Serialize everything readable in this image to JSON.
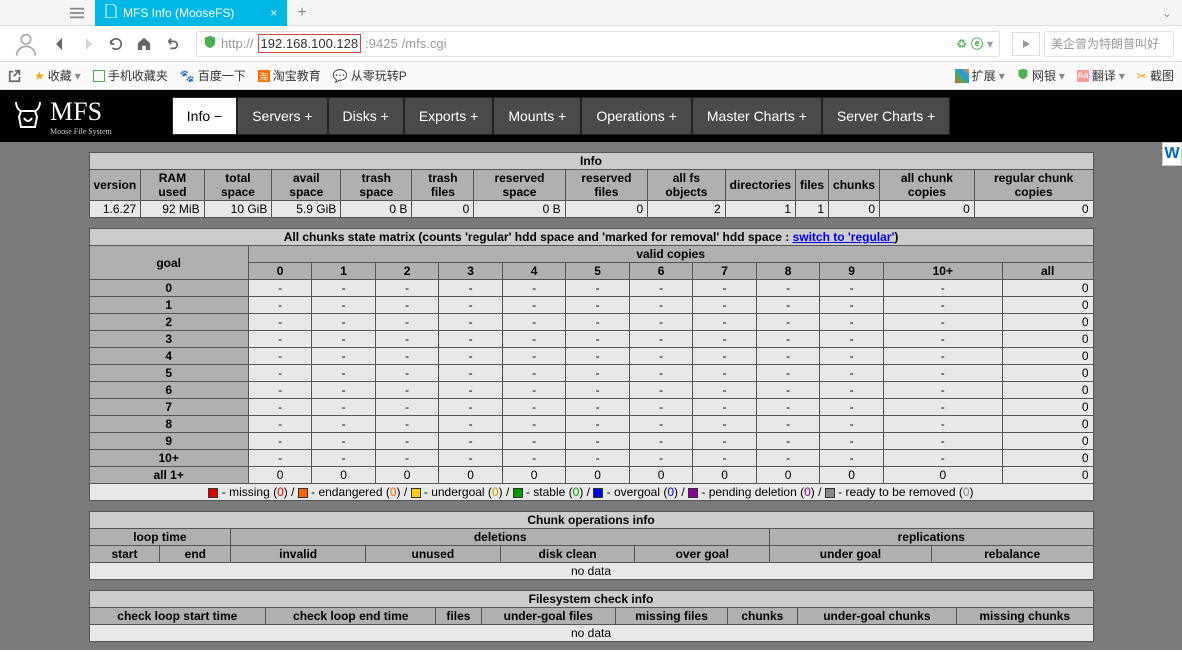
{
  "browser": {
    "tab_title": "MFS Info (MooseFS)",
    "url_display": "http://192.168.100.128:9425/mfs.cgi",
    "url_host": "192.168.100.128",
    "url_port": ":9425",
    "url_prefix": "http://",
    "url_path": "/mfs.cgi",
    "search_placeholder": "美企曾为特朗普叫好"
  },
  "bookmarks": {
    "fav": "收藏",
    "mobile": "手机收藏夹",
    "baidu": "百度一下",
    "taobao": "淘宝教育",
    "learn": "从零玩转P",
    "ext": "扩展",
    "bank": "网银",
    "trans": "翻译",
    "shot": "截图"
  },
  "menu": [
    "Info −",
    "Servers +",
    "Disks +",
    "Exports +",
    "Mounts +",
    "Operations +",
    "Master Charts +",
    "Server Charts +"
  ],
  "logo": {
    "main": "MFS",
    "sub": "Moose File System"
  },
  "info": {
    "title": "Info",
    "headers": [
      "version",
      "RAM used",
      "total space",
      "avail space",
      "trash space",
      "trash files",
      "reserved space",
      "reserved files",
      "all fs objects",
      "directories",
      "files",
      "chunks",
      "all chunk copies",
      "regular chunk copies"
    ],
    "row": [
      "1.6.27",
      "92 MiB",
      "10 GiB",
      "5.9 GiB",
      "0 B",
      "0",
      "0 B",
      "0",
      "2",
      "1",
      "1",
      "0",
      "0",
      "0"
    ]
  },
  "matrix": {
    "title_pre": "All chunks state matrix (counts 'regular' hdd space and 'marked for removal' hdd space : ",
    "link": "switch to 'regular'",
    "title_post": ")",
    "goal": "goal",
    "valid": "valid copies",
    "cols": [
      "0",
      "1",
      "2",
      "3",
      "4",
      "5",
      "6",
      "7",
      "8",
      "9",
      "10+",
      "all"
    ],
    "rows": [
      "0",
      "1",
      "2",
      "3",
      "4",
      "5",
      "6",
      "7",
      "8",
      "9",
      "10+",
      "all 1+"
    ],
    "legend": {
      "missing": " - missing (",
      "endangered": " - endangered (",
      "undergoal": " - undergoal (",
      "stable": " - stable (",
      "overgoal": " - overgoal (",
      "pending": " - pending deletion (",
      "ready": " - ready to be removed (",
      "zero": "0",
      "close": ") / ",
      "closeend": ")"
    }
  },
  "chunkops": {
    "title": "Chunk operations info",
    "loop": "loop time",
    "del": "deletions",
    "rep": "replications",
    "h2": [
      "start",
      "end",
      "invalid",
      "unused",
      "disk clean",
      "over goal",
      "under goal",
      "rebalance"
    ],
    "nodata": "no data"
  },
  "fscheck": {
    "title": "Filesystem check info",
    "headers": [
      "check loop start time",
      "check loop end time",
      "files",
      "under-goal files",
      "missing files",
      "chunks",
      "under-goal chunks",
      "missing chunks"
    ],
    "nodata": "no data"
  }
}
